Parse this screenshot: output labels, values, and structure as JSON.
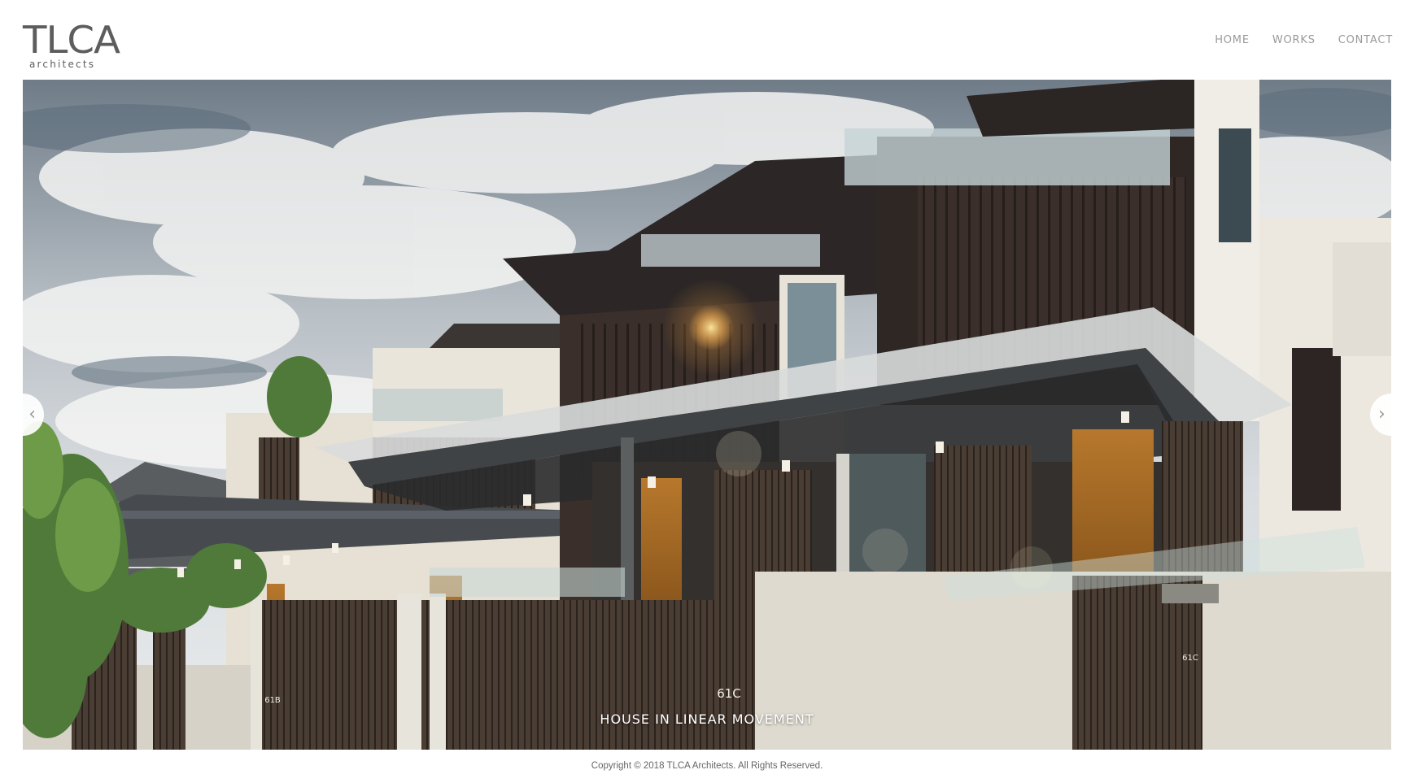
{
  "header": {
    "logo_mark": "TLCA",
    "logo_sub": "architects",
    "nav": [
      "HOME",
      "WORKS",
      "CONTACT"
    ]
  },
  "slider": {
    "caption": "HOUSE IN LINEAR MOVEMENT",
    "house_number_main": "61C",
    "house_number_left": "61B",
    "house_plate": "61C",
    "prev_icon": "chevron-left-icon",
    "next_icon": "chevron-right-icon"
  },
  "footer": {
    "copyright": "Copyright © 2018 TLCA Architects. All Rights Reserved."
  },
  "colors": {
    "nav_text": "#9a9a9a",
    "logo": "#5d5d5d",
    "footer_text": "#666666"
  }
}
